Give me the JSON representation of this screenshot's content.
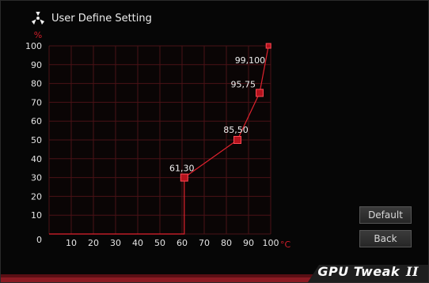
{
  "window": {
    "title": "User Define Setting",
    "title_icon": "fan-icon"
  },
  "chart_data": {
    "type": "line",
    "title": "",
    "xlabel": "°C",
    "ylabel": "%",
    "xlim": [
      0,
      100
    ],
    "ylim": [
      0,
      100
    ],
    "x_ticks": [
      "10",
      "20",
      "30",
      "40",
      "50",
      "60",
      "70",
      "80",
      "90",
      "100"
    ],
    "y_ticks": [
      "0",
      "10",
      "20",
      "30",
      "40",
      "50",
      "60",
      "70",
      "80",
      "90",
      "100"
    ],
    "grid": true,
    "series": [
      {
        "points": [
          [
            0,
            0
          ],
          [
            61,
            0
          ],
          [
            61,
            30
          ],
          [
            85,
            50
          ],
          [
            95,
            75
          ],
          [
            99,
            100
          ]
        ]
      }
    ],
    "control_points": [
      {
        "x": 61,
        "y": 30,
        "label": "61,30"
      },
      {
        "x": 85,
        "y": 50,
        "label": "85,50"
      },
      {
        "x": 95,
        "y": 75,
        "label": "95,75"
      },
      {
        "x": 99,
        "y": 100,
        "label": "99,100"
      }
    ],
    "colors": {
      "curve": "#e0222e",
      "grid": "#4a1216",
      "axis_unit": "#d21e2a"
    }
  },
  "buttons": {
    "default_label": "Default",
    "back_label": "Back"
  },
  "brand": {
    "name": "GPU Tweak",
    "suffix": "II"
  }
}
